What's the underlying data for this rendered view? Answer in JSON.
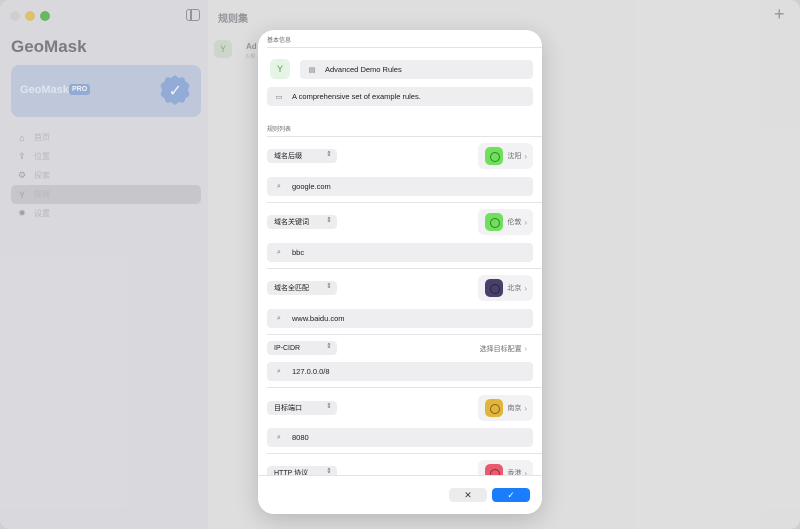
{
  "app": {
    "name": "GeoMask",
    "pro_name": "GeoMask",
    "pro_badge": "PRO"
  },
  "sidebar": {
    "items": [
      {
        "label": "首页",
        "icon": "home-icon",
        "glyph": "⌂"
      },
      {
        "label": "位置",
        "icon": "location-icon",
        "glyph": "⇪"
      },
      {
        "label": "探索",
        "icon": "explore-icon",
        "glyph": "⚙"
      },
      {
        "label": "规则",
        "icon": "rules-icon",
        "glyph": "Y"
      },
      {
        "label": "设置",
        "icon": "gear-icon",
        "glyph": "✹"
      }
    ],
    "active_index": 3
  },
  "main": {
    "title": "规则集",
    "row_name": "Ad",
    "row_sub": "6 规"
  },
  "sheet": {
    "basic_info_title": "基本信息",
    "name_value": "Advanced Demo Rules",
    "description_value": "A comprehensive set of example rules.",
    "rules_list_title": "规则列表",
    "rules": [
      {
        "type": "域名后缀",
        "value": "google.com",
        "target": "沈阳",
        "flag_color": "#6ee05b"
      },
      {
        "type": "域名关键词",
        "value": "bbc",
        "target": "伦敦",
        "flag_color": "#6ee05b"
      },
      {
        "type": "域名全匹配",
        "value": "www.baidu.com",
        "target": "北京",
        "flag_color": "#4a3f6b"
      },
      {
        "type": "IP-CIDR",
        "value": "127.0.0.0/8",
        "target": "选择目标配置",
        "flag_color": ""
      },
      {
        "type": "目标端口",
        "value": "8080",
        "target": "南京",
        "flag_color": "#e3b43a"
      },
      {
        "type": "HTTP 协议",
        "value": "",
        "target": "香港",
        "flag_color": "#ea5a6e"
      }
    ],
    "cancel_label": "✕",
    "confirm_label": "✓"
  }
}
